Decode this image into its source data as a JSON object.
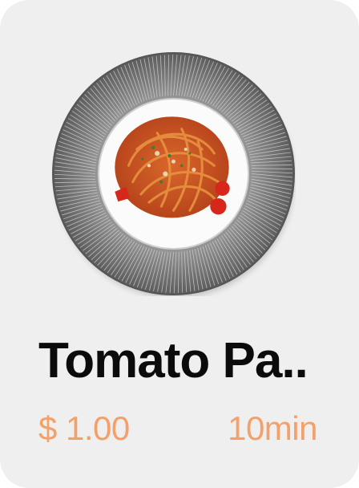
{
  "card": {
    "image_alt": "tomato pasta plate",
    "title": "Tomato Pa..",
    "price": "$ 1.00",
    "prep_time": "10min"
  },
  "colors": {
    "card_background": "#efefef",
    "title": "#0b0b0b",
    "accent": "#f4a06a"
  }
}
